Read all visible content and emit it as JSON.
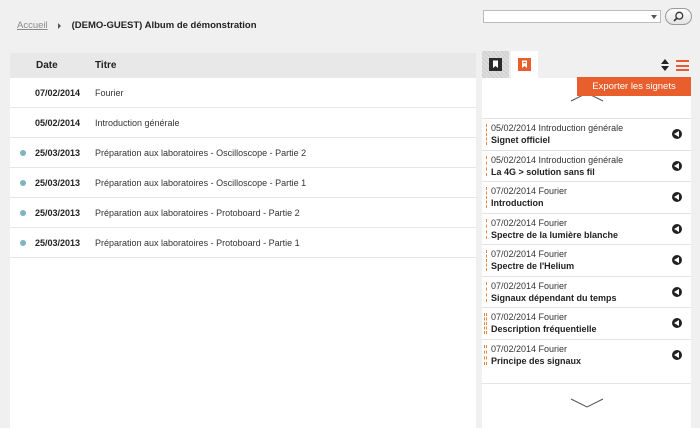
{
  "breadcrumb": {
    "home": "Accueil",
    "current": "(DEMO-GUEST) Album de démonstration"
  },
  "search": {
    "selected": "",
    "button_icon": "search-icon"
  },
  "table": {
    "columns": [
      "Date",
      "Titre"
    ],
    "rows": [
      {
        "date": "07/02/2014",
        "title": "Fourier",
        "marker": false
      },
      {
        "date": "05/02/2014",
        "title": "Introduction générale",
        "marker": false
      },
      {
        "date": "25/03/2013",
        "title": "Préparation aux laboratoires - Oscilloscope - Partie 2",
        "marker": true
      },
      {
        "date": "25/03/2013",
        "title": "Préparation aux laboratoires - Oscilloscope - Partie 1",
        "marker": true
      },
      {
        "date": "25/03/2013",
        "title": "Préparation aux laboratoires - Protoboard - Partie 2",
        "marker": true
      },
      {
        "date": "25/03/2013",
        "title": "Préparation aux laboratoires - Protoboard - Partie 1",
        "marker": true
      }
    ]
  },
  "bookmarks": {
    "export_label": "Exporter les signets",
    "tabs": [
      "bookmark-icon",
      "user-bookmark-icon"
    ],
    "items": [
      {
        "meta": "05/02/2014 Introduction générale",
        "name": "Signet officiel",
        "double": false
      },
      {
        "meta": "05/02/2014 Introduction générale",
        "name": "La 4G > solution sans fil",
        "double": false
      },
      {
        "meta": "07/02/2014 Fourier",
        "name": "Introduction",
        "double": false
      },
      {
        "meta": "07/02/2014 Fourier",
        "name": "Spectre de la lumière blanche",
        "double": false
      },
      {
        "meta": "07/02/2014 Fourier",
        "name": "Spectre de l'Helium",
        "double": false
      },
      {
        "meta": "07/02/2014 Fourier",
        "name": "Signaux dépendant du temps",
        "double": false
      },
      {
        "meta": "07/02/2014 Fourier",
        "name": "Description fréquentielle",
        "double": true
      },
      {
        "meta": "07/02/2014 Fourier",
        "name": "Principe des signaux",
        "double": true
      }
    ]
  },
  "colors": {
    "accent": "#e85f2d",
    "marker": "#7fb3bf"
  }
}
